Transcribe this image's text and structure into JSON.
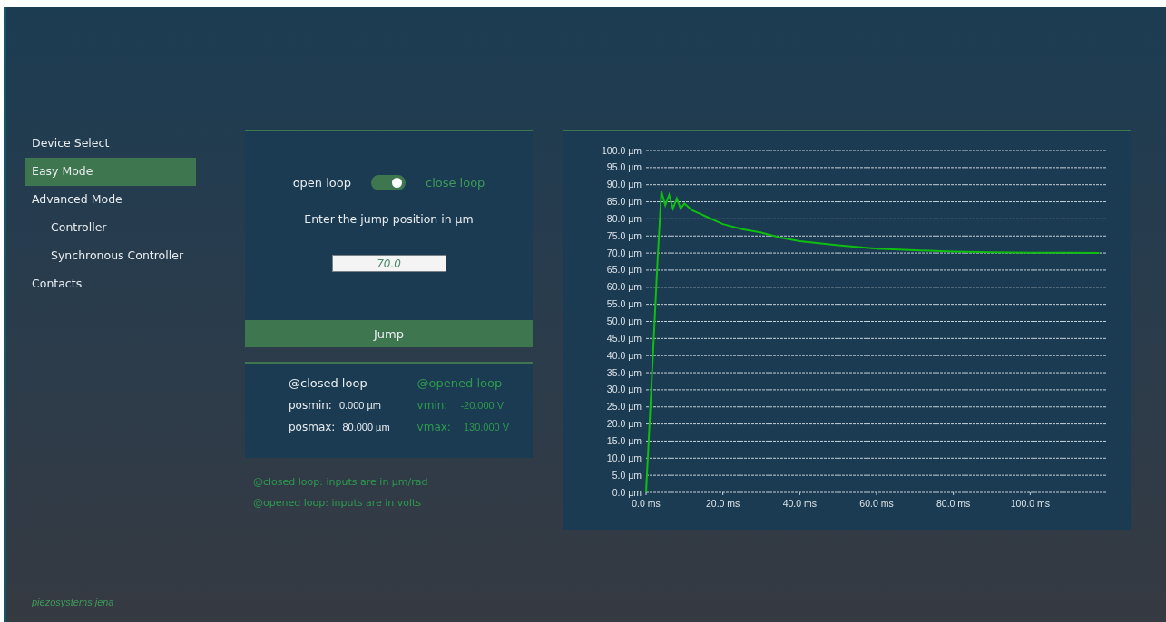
{
  "sidebar": {
    "items": [
      {
        "label": "Device Select",
        "selected": false
      },
      {
        "label": "Easy Mode",
        "selected": true
      },
      {
        "label": "Advanced Mode",
        "selected": false,
        "children": [
          {
            "label": "Controller",
            "selected": false
          },
          {
            "label": "Synchronous Controller",
            "selected": false
          }
        ]
      },
      {
        "label": "Contacts",
        "selected": false
      }
    ]
  },
  "brand": "piezosystems jena",
  "control": {
    "open_label": "open loop",
    "close_label": "close loop",
    "toggle": {
      "on": true
    },
    "prompt": "Enter the jump position in µm",
    "position_field": {
      "value": "70.0"
    },
    "jump_button": "Jump"
  },
  "limits": {
    "closed": {
      "heading": "@closed loop",
      "rows": [
        {
          "label": "posmin:",
          "value": "0.000 µm"
        },
        {
          "label": "posmax:",
          "value": "80.000 µm"
        }
      ]
    },
    "opened": {
      "heading": "@opened loop",
      "rows": [
        {
          "label": "vmin:",
          "value": "-20.000 V"
        },
        {
          "label": "vmax:",
          "value": "130.000 V"
        }
      ]
    }
  },
  "notes": [
    "@closed loop:  inputs are in µm/rad",
    "@opened loop:  inputs are in volts"
  ],
  "chart": {
    "chart_data": {
      "type": "line",
      "x": [
        0,
        1,
        2,
        3,
        4,
        5,
        6,
        7,
        8,
        9,
        10,
        12,
        14,
        16,
        18,
        20,
        25,
        30,
        35,
        40,
        50,
        60,
        70,
        80,
        90,
        100,
        110,
        118
      ],
      "grid": true,
      "series": [
        {
          "color": "#0fbf0f",
          "values": [
            0,
            22,
            45,
            68,
            88,
            84,
            87,
            83,
            86,
            83,
            84.5,
            82.5,
            81.5,
            80.5,
            79.5,
            78.5,
            77,
            76,
            74.5,
            73.5,
            72.3,
            71.3,
            70.8,
            70.4,
            70.2,
            70.1,
            70.1,
            70.0
          ]
        }
      ],
      "xlim": [
        0,
        120
      ],
      "ylim": [
        0,
        100
      ],
      "xticks": [
        {
          "value": 0,
          "label": "0.0 ms"
        },
        {
          "value": 20,
          "label": "20.0 ms"
        },
        {
          "value": 40,
          "label": "40.0 ms"
        },
        {
          "value": 60,
          "label": "60.0 ms"
        },
        {
          "value": 80,
          "label": "80.0 ms"
        },
        {
          "value": 100,
          "label": "100.0 ms"
        }
      ],
      "yticks": [
        {
          "value": 0,
          "label": "0.0 µm"
        },
        {
          "value": 5,
          "label": "5.0 µm"
        },
        {
          "value": 10,
          "label": "10.0 µm"
        },
        {
          "value": 15,
          "label": "15.0 µm"
        },
        {
          "value": 20,
          "label": "20.0 µm"
        },
        {
          "value": 25,
          "label": "25.0 µm"
        },
        {
          "value": 30,
          "label": "30.0 µm"
        },
        {
          "value": 35,
          "label": "35.0 µm"
        },
        {
          "value": 40,
          "label": "40.0 µm"
        },
        {
          "value": 45,
          "label": "45.0 µm"
        },
        {
          "value": 50,
          "label": "50.0 µm"
        },
        {
          "value": 55,
          "label": "55.0 µm"
        },
        {
          "value": 60,
          "label": "60.0 µm"
        },
        {
          "value": 65,
          "label": "65.0 µm"
        },
        {
          "value": 70,
          "label": "70.0 µm"
        },
        {
          "value": 75,
          "label": "75.0 µm"
        },
        {
          "value": 80,
          "label": "80.0 µm"
        },
        {
          "value": 85,
          "label": "85.0 µm"
        },
        {
          "value": 90,
          "label": "90.0 µm"
        },
        {
          "value": 95,
          "label": "95.0 µm"
        },
        {
          "value": 100,
          "label": "100.0 µm"
        }
      ]
    }
  }
}
